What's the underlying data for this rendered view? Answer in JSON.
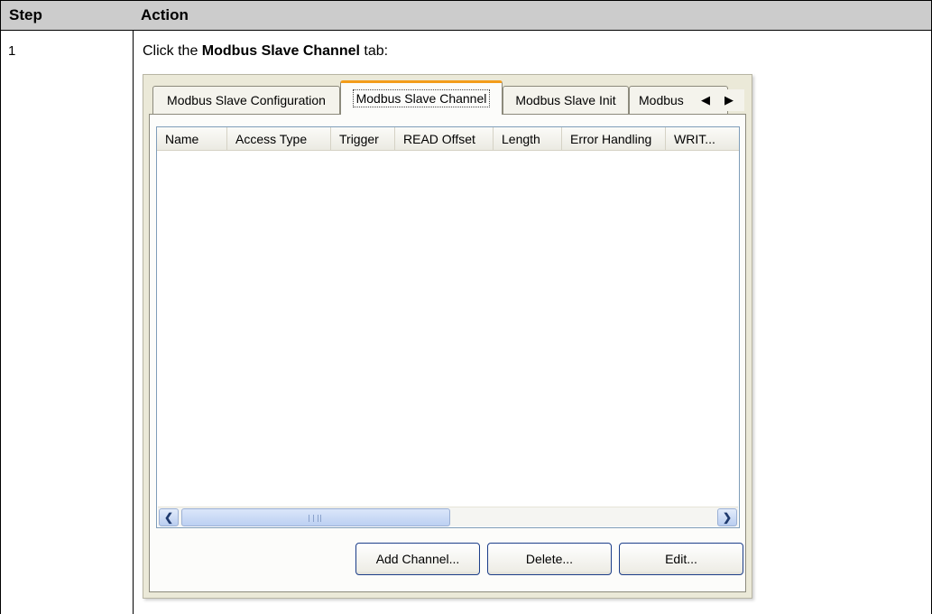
{
  "table": {
    "header": {
      "step": "Step",
      "action": "Action"
    },
    "row": {
      "step": "1",
      "instruction_prefix": "Click the ",
      "instruction_bold": "Modbus Slave Channel",
      "instruction_suffix": " tab:"
    }
  },
  "screenshot": {
    "tabs": [
      {
        "label": "Modbus Slave Configuration",
        "active": false
      },
      {
        "label": "Modbus Slave Channel",
        "active": true
      },
      {
        "label": "Modbus Slave Init",
        "active": false
      },
      {
        "label": "Modbus",
        "active": false
      }
    ],
    "tab_scroll": {
      "left_icon": "triangle-left-icon",
      "right_icon": "triangle-right-icon"
    },
    "columns": [
      "Name",
      "Access Type",
      "Trigger",
      "READ Offset",
      "Length",
      "Error Handling",
      "WRIT..."
    ],
    "rows": [],
    "scrollbar": {
      "left_icon": "chevron-left-icon",
      "right_icon": "chevron-right-icon"
    },
    "buttons": {
      "add": "Add Channel...",
      "delete": "Delete...",
      "edit": "Edit..."
    },
    "colors": {
      "active_tab_accent": "#f39c1a",
      "panel_bg": "#ebe9d8",
      "scroll_blue": "#bcd0f2",
      "button_border": "#1d3f8a"
    }
  }
}
